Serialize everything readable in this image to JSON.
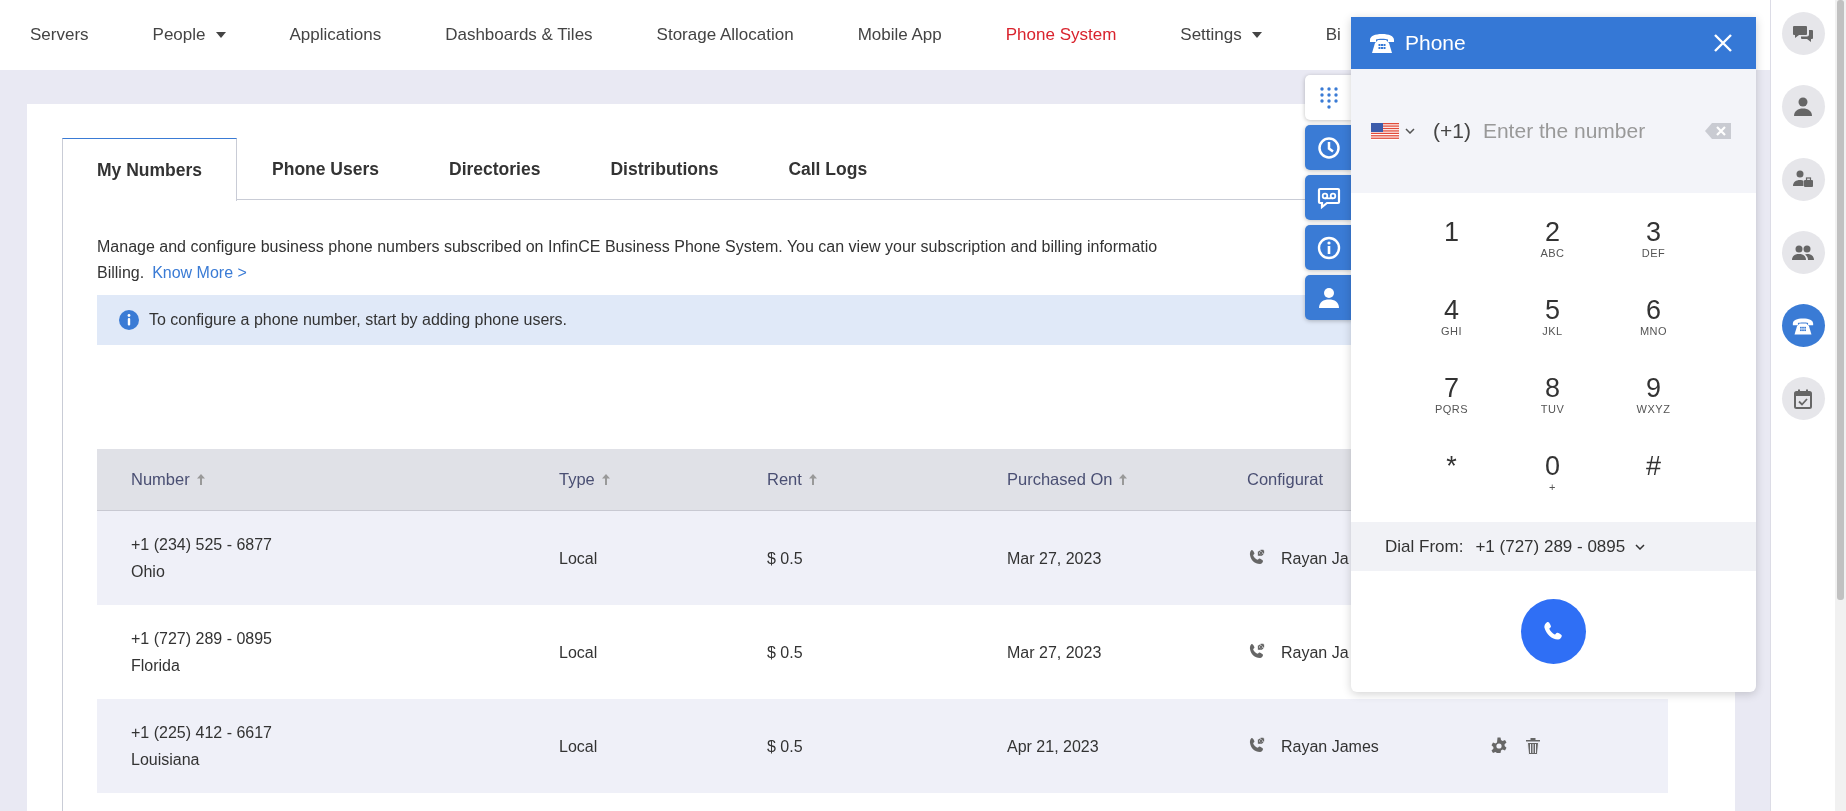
{
  "nav": {
    "items": [
      {
        "label": "Servers",
        "selected": false,
        "dropdown": false
      },
      {
        "label": "People",
        "selected": false,
        "dropdown": true
      },
      {
        "label": "Applications",
        "selected": false,
        "dropdown": false
      },
      {
        "label": "Dashboards & Tiles",
        "selected": false,
        "dropdown": false
      },
      {
        "label": "Storage Allocation",
        "selected": false,
        "dropdown": false
      },
      {
        "label": "Mobile App",
        "selected": false,
        "dropdown": false
      },
      {
        "label": "Phone System",
        "selected": true,
        "dropdown": false
      },
      {
        "label": "Settings",
        "selected": false,
        "dropdown": true
      },
      {
        "label": "Bi",
        "selected": false,
        "dropdown": false
      }
    ]
  },
  "tabs": [
    {
      "label": "My Numbers",
      "selected": true
    },
    {
      "label": "Phone Users",
      "selected": false
    },
    {
      "label": "Directories",
      "selected": false
    },
    {
      "label": "Distributions",
      "selected": false
    },
    {
      "label": "Call Logs",
      "selected": false
    }
  ],
  "description": {
    "lines": [
      "Manage and configure business phone numbers subscribed on InfinCE Business Phone System. You can view your subscription and billing informatio",
      "Billing."
    ],
    "link": "Know More >"
  },
  "banner": {
    "text": "To configure a phone number, start by adding phone users."
  },
  "table": {
    "columns": [
      {
        "label": "Number",
        "sortable": true
      },
      {
        "label": "Type",
        "sortable": true
      },
      {
        "label": "Rent",
        "sortable": true
      },
      {
        "label": "Purchased On",
        "sortable": true
      },
      {
        "label": "Configurat",
        "sortable": false
      }
    ],
    "rows": [
      {
        "number": "+1 (234) 525 - 6877",
        "location": "Ohio",
        "type": "Local",
        "rent": "$ 0.5",
        "purchased_on": "Mar 27, 2023",
        "configured_to": "Rayan Ja",
        "actions": false
      },
      {
        "number": "+1 (727) 289 - 0895",
        "location": "Florida",
        "type": "Local",
        "rent": "$ 0.5",
        "purchased_on": "Mar 27, 2023",
        "configured_to": "Rayan Ja",
        "actions": false
      },
      {
        "number": "+1 (225) 412 - 6617",
        "location": "Louisiana",
        "type": "Local",
        "rent": "$ 0.5",
        "purchased_on": "Apr 21, 2023",
        "configured_to": "Rayan James",
        "actions": true
      }
    ]
  },
  "side_tabs": [
    {
      "kind": "dialpad",
      "selected": true
    },
    {
      "kind": "history",
      "selected": false
    },
    {
      "kind": "voicemail",
      "selected": false
    },
    {
      "kind": "info",
      "selected": false
    },
    {
      "kind": "contact",
      "selected": false
    }
  ],
  "phone_panel": {
    "title": "Phone",
    "country_code": "(+1)",
    "placeholder": "Enter the number",
    "keys": [
      {
        "digit": "1"
      },
      {
        "digit": "2",
        "letters": "ABC"
      },
      {
        "digit": "3",
        "letters": "DEF"
      },
      {
        "digit": "4",
        "letters": "GHI"
      },
      {
        "digit": "5",
        "letters": "JKL"
      },
      {
        "digit": "6",
        "letters": "MNO"
      },
      {
        "digit": "7",
        "letters": "PQRS"
      },
      {
        "digit": "8",
        "letters": "TUV"
      },
      {
        "digit": "9",
        "letters": "WXYZ"
      },
      {
        "digit": "*"
      },
      {
        "digit": "0",
        "letters": "+"
      },
      {
        "digit": "#"
      }
    ],
    "dial_from": {
      "label": "Dial From:",
      "value": "+1 (727) 289 - 0895"
    }
  },
  "sidebar": {
    "items": [
      {
        "kind": "chat",
        "selected": false
      },
      {
        "kind": "user",
        "selected": false
      },
      {
        "kind": "business-user",
        "selected": false
      },
      {
        "kind": "users",
        "selected": false
      },
      {
        "kind": "phone",
        "selected": true
      },
      {
        "kind": "calendar",
        "selected": false
      }
    ]
  }
}
